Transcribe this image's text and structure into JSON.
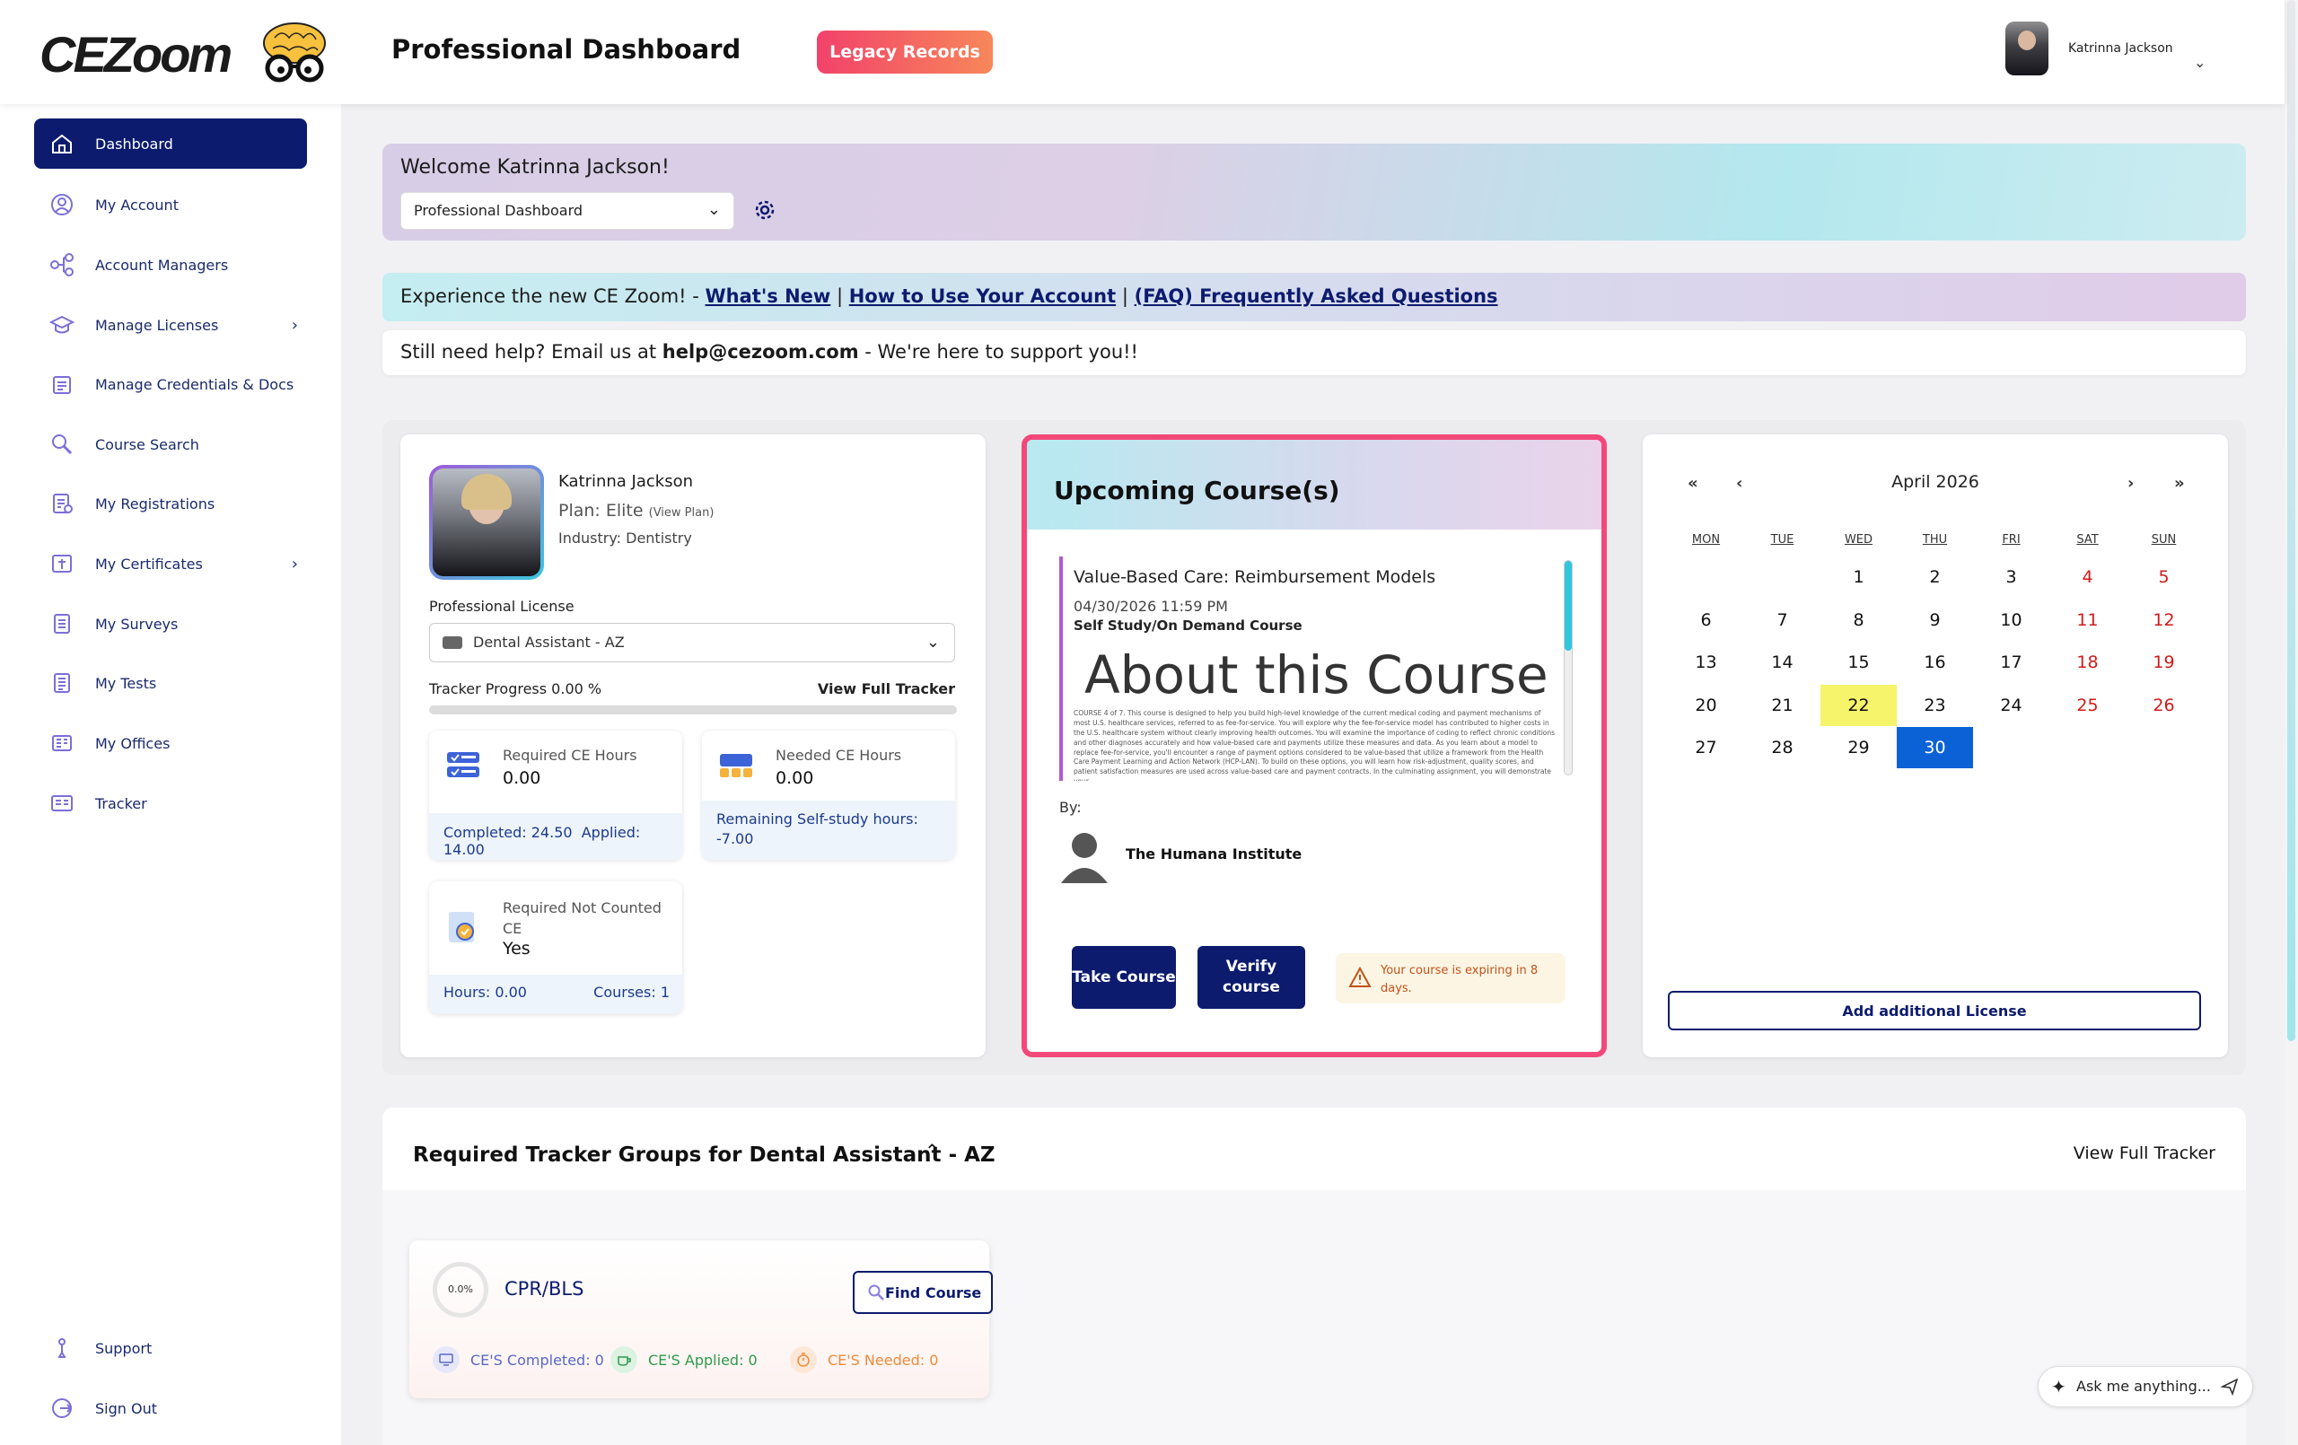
{
  "header": {
    "logo_text": "CEZoom",
    "page_title": "Professional Dashboard",
    "legacy_button": "Legacy Records",
    "user_name": "Katrinna Jackson"
  },
  "sidebar": {
    "items": [
      {
        "label": "Dashboard",
        "icon": "home-icon",
        "active": true
      },
      {
        "label": "My Account",
        "icon": "user-circle-icon"
      },
      {
        "label": "Account Managers",
        "icon": "network-icon"
      },
      {
        "label": "Manage Licenses",
        "icon": "graduation-cap-icon",
        "expandable": true
      },
      {
        "label": "Manage Credentials & Docs",
        "icon": "documents-icon"
      },
      {
        "label": "Course Search",
        "icon": "search-icon"
      },
      {
        "label": "My Registrations",
        "icon": "registration-icon"
      },
      {
        "label": "My Certificates",
        "icon": "certificate-icon",
        "expandable": true
      },
      {
        "label": "My Surveys",
        "icon": "survey-icon"
      },
      {
        "label": "My Tests",
        "icon": "test-icon"
      },
      {
        "label": "My Offices",
        "icon": "office-icon"
      },
      {
        "label": "Tracker",
        "icon": "tracker-icon"
      }
    ],
    "support": "Support",
    "sign_out": "Sign Out"
  },
  "welcome": {
    "title": "Welcome Katrinna Jackson!",
    "dashboard_select": "Professional Dashboard"
  },
  "banner": {
    "prefix": "Experience the new CE Zoom! - ",
    "link1": "What's New",
    "sep1": " | ",
    "link2": "How to Use Your Account",
    "sep2": " | ",
    "link3": "(FAQ) Frequently Asked Questions"
  },
  "help": {
    "prefix": "Still need help? Email us at ",
    "email": "help@cezoom.com",
    "suffix": " - We're here to support you!!"
  },
  "profile": {
    "name": "Katrinna Jackson",
    "plan": "Plan: Elite",
    "view_plan": "(View Plan)",
    "industry": "Industry: Dentistry",
    "license_label": "Professional License",
    "license_value": "Dental Assistant - AZ",
    "tracker_progress": "Tracker Progress 0.00 %",
    "tracker_percent": 0,
    "view_full_tracker": "View Full Tracker",
    "required_ce": {
      "label": "Required CE Hours",
      "value": "0.00",
      "completed": "Completed: 24.50",
      "applied": "Applied: 14.00"
    },
    "needed_ce": {
      "label": "Needed CE Hours",
      "value": "0.00",
      "remaining": "Remaining Self-study hours:",
      "remaining_value": "-7.00"
    },
    "not_counted": {
      "label": "Required Not Counted CE",
      "value": "Yes",
      "hours": "Hours: 0.00",
      "courses": "Courses: 1"
    }
  },
  "upcoming": {
    "title": "Upcoming Course(s)",
    "course_title": "Value-Based Care: Reimbursement Models",
    "date": "04/30/2026 11:59 PM",
    "type": "Self Study/On Demand Course",
    "about": "About this Course",
    "description": "COURSE 4 of 7. This course is designed to help you build high-level knowledge of the current medical coding and payment mechanisms of most U.S. healthcare services, referred to as fee-for-service. You will explore why the fee-for-service model has contributed to higher costs in the U.S. healthcare system without clearly improving health outcomes. You will examine the importance of coding to reflect chronic conditions and other diagnoses accurately and how value-based care and payments utilize these measures and data. As you learn about a model to replace fee-for-service, you'll encounter a range of payment options considered to be value-based that utilize a framework from the Health Care Payment Learning and Action Network (HCP-LAN). To build on these options, you will learn how risk-adjustment, quality scores, and patient satisfaction measures are used across value-based care and payment contracts. In the culminating assignment, you will demonstrate your",
    "by": "By:",
    "instructor": "The Humana Institute",
    "take_course": "Take Course",
    "verify_course": "Verify course",
    "warning": "Your course is expiring in 8 days."
  },
  "calendar": {
    "month": "April 2026",
    "nav": {
      "prev_year": "«",
      "prev": "‹",
      "next": "›",
      "next_year": "»"
    },
    "days_of_week": [
      "MON",
      "TUE",
      "WED",
      "THU",
      "FRI",
      "SAT",
      "SUN"
    ],
    "first_weekday_index": 2,
    "days_in_month": 30,
    "today": 22,
    "selected": 30,
    "add_license": "Add additional License"
  },
  "tracker": {
    "title": "Required Tracker Groups for Dental Assistant - AZ",
    "view_full": "View Full Tracker",
    "group": {
      "percent": "0.0%",
      "name": "CPR/BLS",
      "find_course": "Find Course",
      "completed": "CE'S Completed: 0",
      "applied": "CE'S Applied: 0",
      "needed": "CE'S Needed: 0"
    }
  },
  "assistant": {
    "placeholder": "Ask me anything..."
  },
  "colors": {
    "primary": "#0d1b6e",
    "accent": "#f2497a",
    "weekend": "#d21a1a",
    "today": "#f6f46a",
    "selected": "#0b62d6"
  }
}
